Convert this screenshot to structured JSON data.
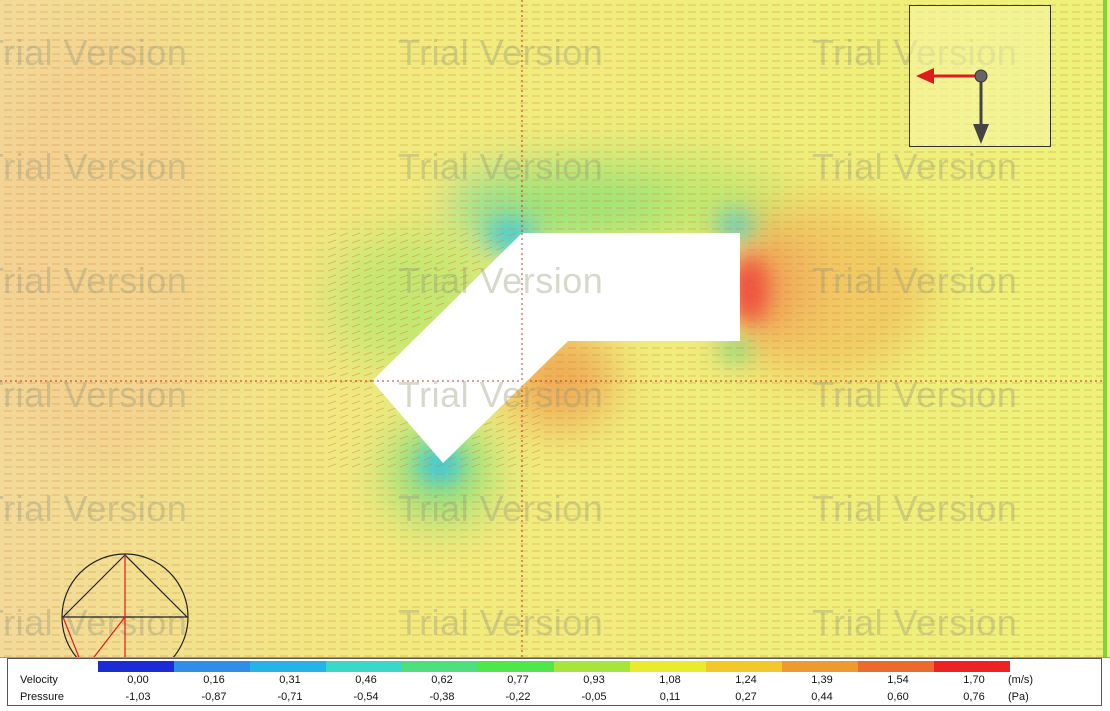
{
  "watermark_text": "Trial Version",
  "legend": {
    "velocity": {
      "label": "Velocity",
      "unit": "(m/s)",
      "values": [
        "0,00",
        "0,16",
        "0,31",
        "0,46",
        "0,62",
        "0,77",
        "0,93",
        "1,08",
        "1,24",
        "1,39",
        "1,54",
        "1,70"
      ],
      "colors": [
        "#1b2bd6",
        "#2f8fe8",
        "#25b4ea",
        "#38d9c8",
        "#4fe07e",
        "#4ee84a",
        "#a6e63a",
        "#e8ec2a",
        "#f2c82a",
        "#f09a2e",
        "#ec6a2c",
        "#ee2222"
      ]
    },
    "pressure": {
      "label": "Pressure",
      "unit": "(Pa)",
      "values": [
        "-1,03",
        "-0,87",
        "-0,71",
        "-0,54",
        "-0,38",
        "-0,22",
        "-0,05",
        "0,11",
        "0,27",
        "0,44",
        "0,60",
        "0,76"
      ]
    }
  },
  "icons": {
    "compass": "flow-direction-icon",
    "view_cube": "view-orientation-icon"
  }
}
